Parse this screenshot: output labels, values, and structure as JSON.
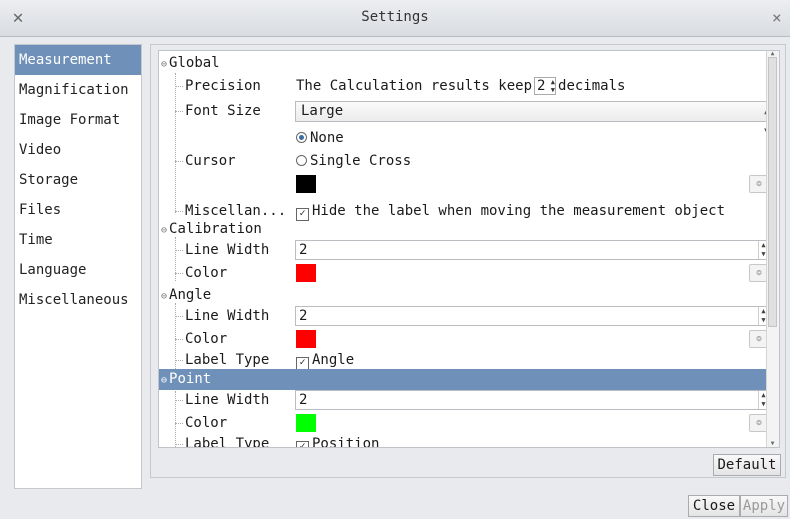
{
  "window": {
    "title": "Settings",
    "close_symbol": "×",
    "app_icon_symbol": "✕"
  },
  "sidebar": {
    "items": [
      {
        "label": "Measurement",
        "selected": true
      },
      {
        "label": "Magnification"
      },
      {
        "label": "Image Format"
      },
      {
        "label": "Video"
      },
      {
        "label": "Storage"
      },
      {
        "label": "Files"
      },
      {
        "label": "Time"
      },
      {
        "label": "Language"
      },
      {
        "label": "Miscellaneous"
      }
    ]
  },
  "tree": {
    "global": {
      "title": "Global",
      "precision_label": "Precision",
      "precision_text_before": "The Calculation results keep",
      "precision_value": "2",
      "precision_text_after": "decimals",
      "font_size_label": "Font Size",
      "font_size_value": "Large",
      "cursor_label": "Cursor",
      "cursor_option_none": "None",
      "cursor_option_single_cross": "Single Cross",
      "cursor_color": "#000000",
      "misc_label": "Miscellan...",
      "misc_checkbox_text": "Hide the label when moving the measurement object"
    },
    "calibration": {
      "title": "Calibration",
      "line_width_label": "Line Width",
      "line_width_value": "2",
      "color_label": "Color",
      "color": "#ff0000"
    },
    "angle": {
      "title": "Angle",
      "line_width_label": "Line Width",
      "line_width_value": "2",
      "color_label": "Color",
      "color": "#ff0000",
      "label_type_label": "Label Type",
      "label_type_value": "Angle"
    },
    "point": {
      "title": "Point",
      "line_width_label": "Line Width",
      "line_width_value": "2",
      "color_label": "Color",
      "color": "#00ff00",
      "label_type_label": "Label Type",
      "label_type_value": "Position"
    }
  },
  "buttons": {
    "default": "Default",
    "close": "Close",
    "apply": "Apply"
  }
}
